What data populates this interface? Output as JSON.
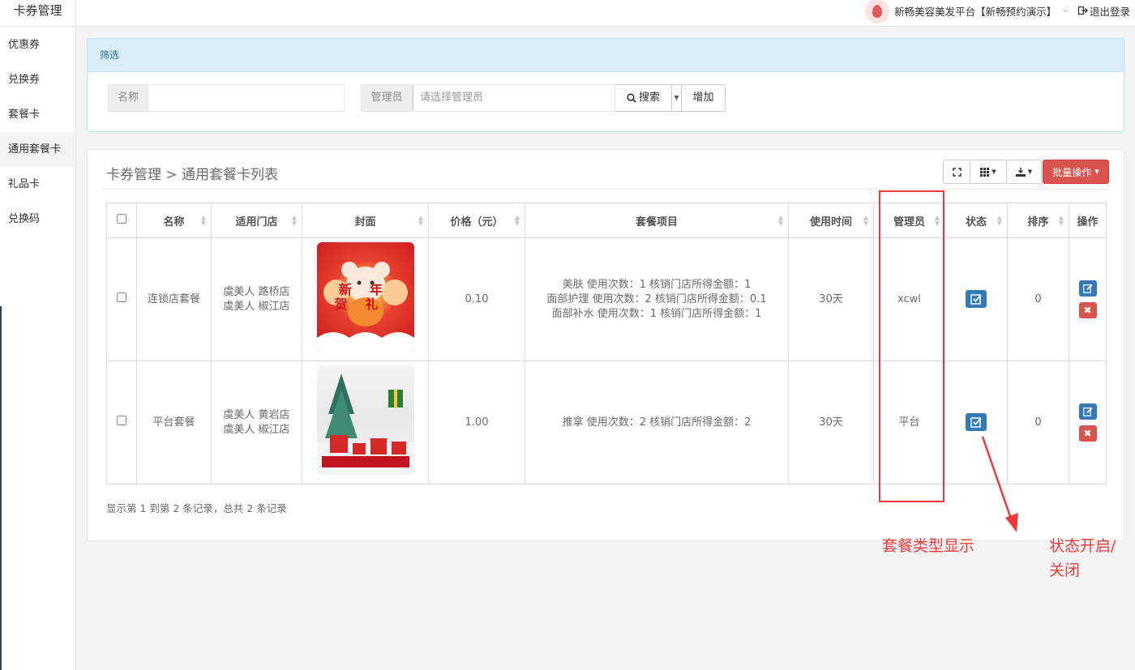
{
  "header": {
    "app_title": "卡券管理",
    "platform_name": "新畅美容美发平台【新畅预约演示】",
    "logout_label": "退出登录"
  },
  "sidebar": {
    "items": [
      {
        "label": "优惠券"
      },
      {
        "label": "兑换券"
      },
      {
        "label": "套餐卡"
      },
      {
        "label": "通用套餐卡",
        "active": true
      },
      {
        "label": "礼品卡"
      },
      {
        "label": "兑换码"
      }
    ]
  },
  "filter": {
    "title": "筛选",
    "name_label": "名称",
    "name_value": "",
    "admin_label": "管理员",
    "admin_placeholder": "请选择管理员",
    "search_label": "搜索",
    "add_label": "增加"
  },
  "list": {
    "breadcrumb": "卡券管理 > 通用套餐卡列表",
    "batch_label": "批量操作",
    "columns": [
      "名称",
      "适用门店",
      "封面",
      "价格（元）",
      "套餐项目",
      "使用时间",
      "管理员",
      "状态",
      "排序",
      "操作"
    ],
    "rows": [
      {
        "name": "连锁店套餐",
        "stores": [
          "虞美人 路桥店",
          "虞美人 椒江店"
        ],
        "cover": "新年贺礼",
        "price": "0.10",
        "items": [
          "美肤 使用次数：1 核销门店所得金额：1",
          "面部护理 使用次数：2 核销门店所得金额：0.1",
          "面部补水 使用次数：1 核销门店所得金额：1"
        ],
        "duration": "30天",
        "admin": "xcwl",
        "sort": "0"
      },
      {
        "name": "平台套餐",
        "stores": [
          "虞美人 黄岩店",
          "虞美人 椒江店"
        ],
        "cover": "",
        "price": "1.00",
        "items": [
          "推拿 使用次数：2 核销门店所得金额：2"
        ],
        "duration": "30天",
        "admin": "平台",
        "sort": "0"
      }
    ],
    "footer": "显示第 1 到第 2 条记录，总共 2 条记录"
  },
  "annotations": {
    "type_note": "套餐类型显示",
    "status_note": "状态开启/关闭"
  },
  "colors": {
    "primary": "#337ab7",
    "danger": "#d9534f",
    "annotation": "#ee3a3a",
    "filter_head_bg": "#d9edf7"
  }
}
